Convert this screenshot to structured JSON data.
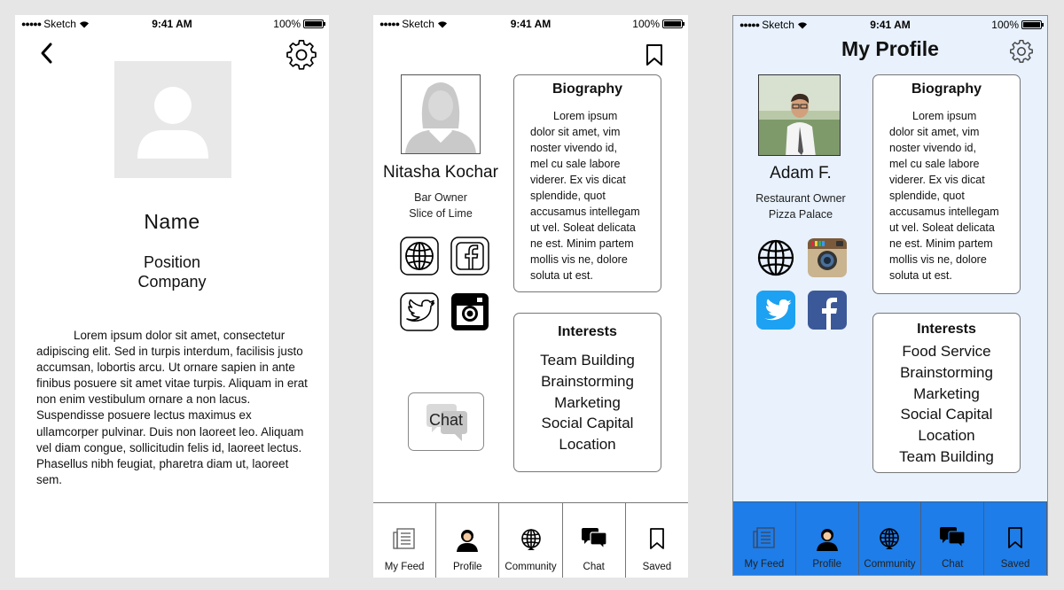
{
  "status_bar": {
    "carrier": "Sketch",
    "time": "9:41 AM",
    "battery": "100%"
  },
  "screen1": {
    "name": "Name",
    "position": "Position",
    "company": "Company",
    "bio": "Lorem ipsum dolor sit amet, consectetur adipiscing elit. Sed in turpis interdum, facilisis justo accumsan, lobortis arcu. Ut ornare sapien in ante finibus posuere sit amet vitae turpis. Aliquam in erat non enim vestibulum ornare a non lacus. Suspendisse posuere lectus maximus ex ullamcorper pulvinar. Duis non laoreet leo. Aliquam vel diam congue, sollicitudin felis id, laoreet lectus. Phasellus nibh feugiat, pharetra diam ut, laoreet sem."
  },
  "screen2": {
    "name": "Nitasha Kochar",
    "role": "Bar Owner",
    "business": "Slice of Lime",
    "biography_title": "Biography",
    "biography_lines": [
      "Lorem ipsum",
      "dolor sit amet, vim",
      "noster vivendo id,",
      "mel cu sale labore",
      "viderer. Ex vis dicat",
      "splendide, quot",
      "accusamus intellegam",
      "ut vel. Soleat delicata",
      "ne est. Minim partem",
      "mollis vis ne, dolore",
      "soluta ut est."
    ],
    "interests_title": "Interests",
    "interests": [
      "Team Building",
      "Brainstorming",
      "Marketing",
      "Social Capital",
      "Location"
    ],
    "chat_button": "Chat"
  },
  "screen3": {
    "title": "My Profile",
    "name": "Adam F.",
    "role": "Restaurant Owner",
    "business": "Pizza Palace",
    "biography_title": "Biography",
    "biography_lines": [
      "Lorem ipsum",
      "dolor sit amet, vim",
      "noster vivendo id,",
      "mel cu sale labore",
      "viderer. Ex vis dicat",
      "splendide, quot",
      "accusamus intellegam",
      "ut vel. Soleat delicata",
      "ne est. Minim partem",
      "mollis vis ne, dolore",
      "soluta ut est."
    ],
    "interests_title": "Interests",
    "interests": [
      "Food Service",
      "Brainstorming",
      "Marketing",
      "Social Capital",
      "Location",
      "Team Building"
    ]
  },
  "tabs": [
    {
      "label": "My Feed",
      "icon": "feed-icon"
    },
    {
      "label": "Profile",
      "icon": "profile-icon"
    },
    {
      "label": "Community",
      "icon": "globe-icon"
    },
    {
      "label": "Chat",
      "icon": "chat-icon"
    },
    {
      "label": "Saved",
      "icon": "bookmark-icon"
    }
  ],
  "colors": {
    "page_background": "#e6e6e6",
    "screen3_background": "#e8f1fc",
    "screen3_tabbar": "#1e7de8",
    "twitter_blue": "#1da1f2",
    "facebook_blue": "#3b5998"
  }
}
